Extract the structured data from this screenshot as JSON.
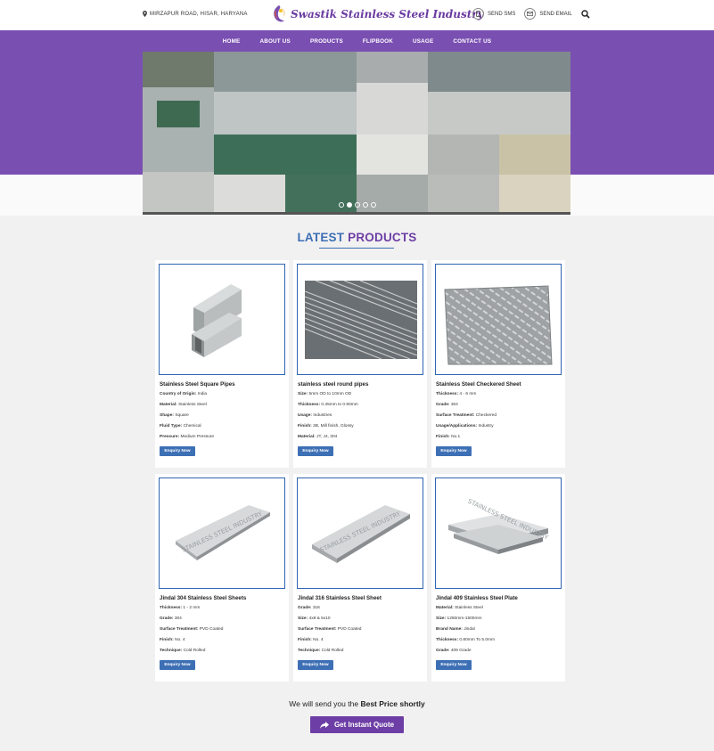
{
  "header": {
    "address": "MIRZAPUR ROAD, HISAR, HARYANA",
    "brand": "Swastik Stainless Steel Industry",
    "send_sms": "SEND SMS",
    "send_email": "SEND EMAIL"
  },
  "nav": {
    "items": [
      "HOME",
      "ABOUT US",
      "PRODUCTS",
      "FLIPBOOK",
      "USAGE",
      "CONTACT US"
    ]
  },
  "section": {
    "title_part1": "LATEST",
    "title_part2": "PRODUCTS"
  },
  "products": [
    {
      "title": "Stainless Steel Square Pipes",
      "specs": [
        {
          "label": "Country of Origin:",
          "value": "India"
        },
        {
          "label": "Material:",
          "value": "Stainless Steel"
        },
        {
          "label": "Shape:",
          "value": "Square"
        },
        {
          "label": "Fluid Type:",
          "value": "Chemical"
        },
        {
          "label": "Pressure:",
          "value": "Medium Pressure"
        }
      ],
      "button": "Enquiry Now"
    },
    {
      "title": "stainless steel round pipes",
      "specs": [
        {
          "label": "Size:",
          "value": "5mm OD to 10mm OD"
        },
        {
          "label": "Thickness:",
          "value": "0.35mm to 0.90mm"
        },
        {
          "label": "Usage:",
          "value": "Industries"
        },
        {
          "label": "Finish:",
          "value": "2B, Mill finish, Glossy"
        },
        {
          "label": "Material:",
          "value": "JT, J4, 304"
        }
      ],
      "button": "Enquiry Now"
    },
    {
      "title": "Stainless Steel Checkered Sheet",
      "specs": [
        {
          "label": "Thickness:",
          "value": "4 - 6 mm"
        },
        {
          "label": "Grade:",
          "value": "304"
        },
        {
          "label": "Surface Treatment:",
          "value": "Checkered"
        },
        {
          "label": "Usage/Applications:",
          "value": "Industry"
        },
        {
          "label": "Finish:",
          "value": "No.1"
        }
      ],
      "button": "Enquiry Now"
    },
    {
      "title": "Jindal 304 Stainless Steel Sheets",
      "specs": [
        {
          "label": "Thickness:",
          "value": "1 - 2 mm"
        },
        {
          "label": "Grade:",
          "value": "304"
        },
        {
          "label": "Surface Treatment:",
          "value": "PVD Coated"
        },
        {
          "label": "Finish:",
          "value": "No. 4"
        },
        {
          "label": "Technique:",
          "value": "Cold Rolled"
        }
      ],
      "button": "Enquiry Now"
    },
    {
      "title": "Jindal 316 Stainless Steel Sheet",
      "specs": [
        {
          "label": "Grade:",
          "value": "316"
        },
        {
          "label": "Size:",
          "value": "4x8 & 5x10"
        },
        {
          "label": "Surface Treatment:",
          "value": "PVD Coated"
        },
        {
          "label": "Finish:",
          "value": "No. 4"
        },
        {
          "label": "Technique:",
          "value": "Cold Rolled"
        }
      ],
      "button": "Enquiry Now"
    },
    {
      "title": "Jindal 409 Stainless Steel Plate",
      "specs": [
        {
          "label": "Material:",
          "value": "Stainless Steel"
        },
        {
          "label": "Size:",
          "value": "1250mm-1500mm"
        },
        {
          "label": "Brand Name:",
          "value": "Jindal"
        },
        {
          "label": "Thickness:",
          "value": "0.80mm To 5.0mm"
        },
        {
          "label": "Grade:",
          "value": "409 Grade"
        }
      ],
      "button": "Enquiry Now"
    }
  ],
  "watermark": "STAINLESS STEEL INDUSTRY",
  "cta": {
    "text_prefix": "We will send you the",
    "text_bold": "Best Price shortly",
    "button": "Get Instant Quote"
  },
  "colors": {
    "brand_purple": "#7a4fb2",
    "accent_blue": "#3d6fb5"
  }
}
